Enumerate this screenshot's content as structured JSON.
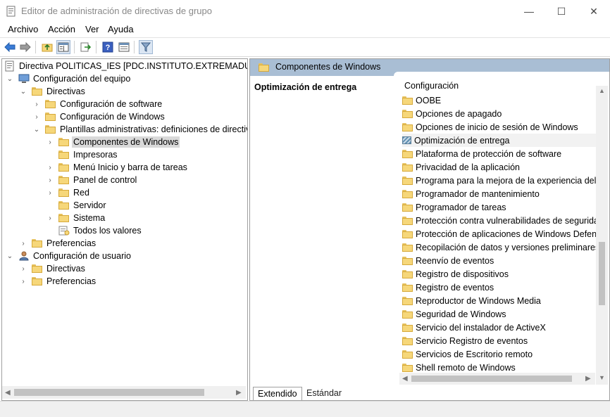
{
  "window": {
    "title": "Editor de administración de directivas de grupo",
    "controls": {
      "minimize": "—",
      "maximize": "☐",
      "close": "✕"
    }
  },
  "menu": {
    "items": [
      "Archivo",
      "Acción",
      "Ver",
      "Ayuda"
    ]
  },
  "toolbar": {
    "buttons": [
      "back-arrow-icon",
      "forward-arrow-icon",
      "up-folder-icon",
      "show-hide-tree-icon",
      "export-list-icon",
      "help-icon",
      "properties-icon",
      "filter-icon"
    ]
  },
  "tree": {
    "root": "Directiva POLITICAS_IES [PDC.INSTITUTO.EXTREMADURA.ES]",
    "computer": "Configuración del equipo",
    "directivas": "Directivas",
    "software": "Configuración de software",
    "windows": "Configuración de Windows",
    "templates": "Plantillas administrativas: definiciones de directiva",
    "components": "Componentes de Windows",
    "printers": "Impresoras",
    "startmenu": "Menú Inicio y barra de tareas",
    "controlpanel": "Panel de control",
    "network": "Red",
    "server": "Servidor",
    "system": "Sistema",
    "allvalues": "Todos los valores",
    "prefs": "Preferencias",
    "user": "Configuración de usuario",
    "user_directivas": "Directivas",
    "user_prefs": "Preferencias"
  },
  "right": {
    "header": "Componentes de Windows",
    "extended_title": "Optimización de entrega",
    "list_header": "Configuración",
    "items": [
      "OOBE",
      "Opciones de apagado",
      "Opciones de inicio de sesión de Windows",
      "Optimización de entrega",
      "Plataforma de protección de software",
      "Privacidad de la aplicación",
      "Programa para la mejora de la experiencia del us",
      "Programador de mantenimiento",
      "Programador de tareas",
      "Protección contra vulnerabilidades de seguridad",
      "Protección de aplicaciones de Windows Defende",
      "Recopilación de datos y versiones preliminares",
      "Reenvío de eventos",
      "Registro de dispositivos",
      "Registro de eventos",
      "Reproductor de Windows Media",
      "Seguridad de Windows",
      "Servicio del instalador de ActiveX",
      "Servicio Registro de eventos",
      "Servicios de Escritorio remoto",
      "Shell remoto de Windows"
    ],
    "tabs": {
      "extended": "Extendido",
      "standard": "Estándar"
    }
  }
}
